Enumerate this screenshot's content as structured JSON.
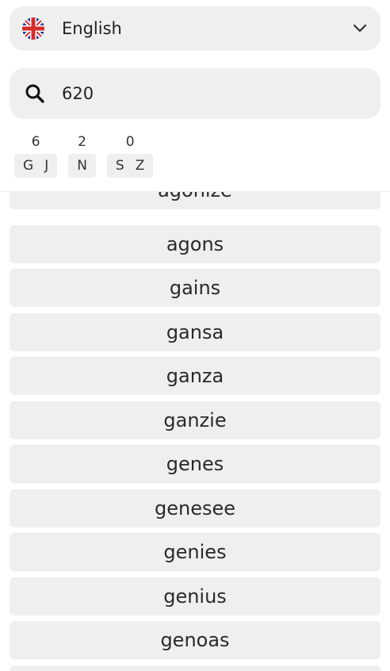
{
  "language": {
    "label": "English",
    "flag": "uk-flag-icon",
    "expand_icon": "chevron-down-icon"
  },
  "search": {
    "value": "620",
    "icon": "search-icon"
  },
  "keys": [
    {
      "digit": "6",
      "letters": [
        "G",
        "J"
      ]
    },
    {
      "digit": "2",
      "letters": [
        "N"
      ]
    },
    {
      "digit": "0",
      "letters": [
        "S",
        "Z"
      ]
    }
  ],
  "results": [
    "agonize",
    "agons",
    "gains",
    "gansa",
    "ganza",
    "ganzie",
    "genes",
    "genesee",
    "genies",
    "genius",
    "genoas",
    ""
  ],
  "colors": {
    "surface": "#efefef",
    "text": "#222222"
  }
}
